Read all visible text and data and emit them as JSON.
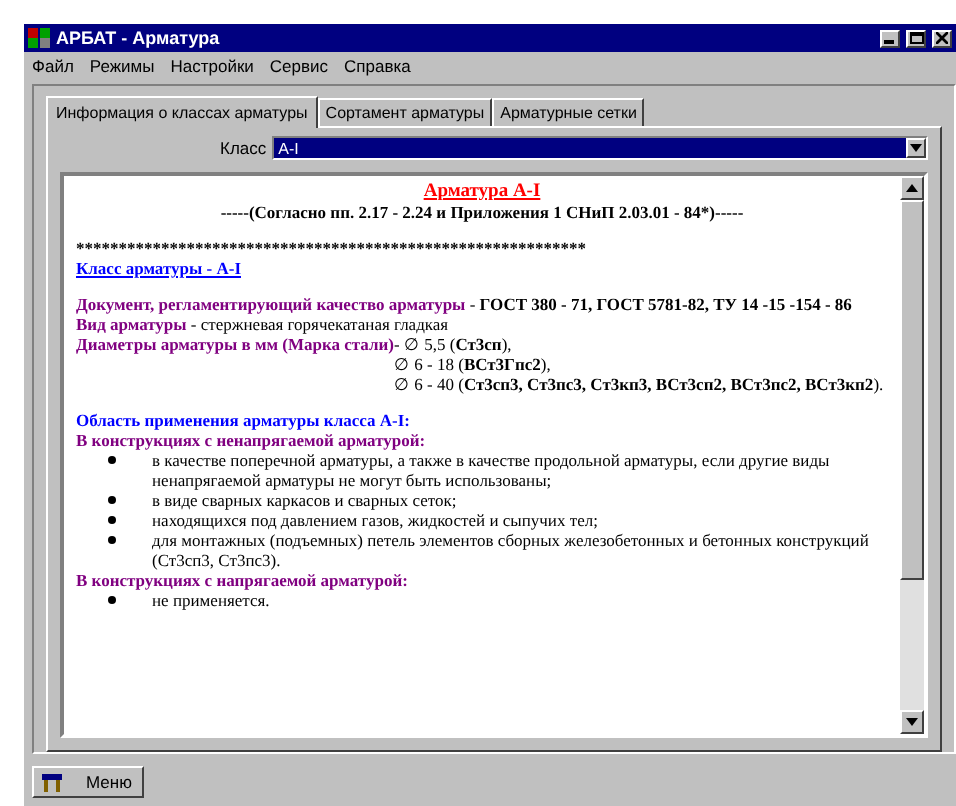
{
  "window": {
    "title": "АРБАТ - Арматура"
  },
  "menu": [
    "Файл",
    "Режимы",
    "Настройки",
    "Сервис",
    "Справка"
  ],
  "tabs": [
    {
      "label": "Информация о классах арматуры",
      "selected": true
    },
    {
      "label": "Сортамент арматуры",
      "selected": false
    },
    {
      "label": "Арматурные сетки",
      "selected": false
    }
  ],
  "class_field": {
    "label": "Класс",
    "value": "A-I"
  },
  "document": [
    {
      "kind": "title",
      "text": "Арматура А-I"
    },
    {
      "kind": "subtitle",
      "text": "-----(Согласно пп. 2.17 - 2.24 и Приложения 1 СНиП 2.03.01 - 84*)-----"
    },
    {
      "kind": "rule",
      "text": "************************************************************"
    },
    {
      "kind": "link",
      "text": " Класс арматуры - А-I"
    },
    {
      "kind": "field",
      "label": "Документ, регламентирующий качество арматуры",
      "value": " - **ГОСТ 380 - 71, ГОСТ 5781-82, ТУ 14 -15 -154 - 86**"
    },
    {
      "kind": "field",
      "label": "Вид арматуры",
      "value": " - стержневая горячекатаная гладкая"
    },
    {
      "kind": "lines",
      "label": "Диаметры арматуры в мм (Марка стали)",
      "lines": [
        " - ∅ 5,5 (**Ст3сп**),",
        "∅ 6 - 18 (**ВСт3Гпс2**),",
        "∅ 6 -  40 (**Ст3сп3, Ст3пс3, Ст3кп3, ВСт3сп2, ВСт3пс2, ВСт3кп2**)."
      ]
    },
    {
      "kind": "heading",
      "text": "Область применения арматуры класса А-I:"
    },
    {
      "kind": "subheading",
      "text": "В конструкциях с ненапрягаемой арматурой:"
    },
    {
      "kind": "bullet",
      "text": "в качестве поперечной арматуры, а также в качестве продольной арматуры, если другие виды ненапрягаемой арматуры не могут быть использованы;"
    },
    {
      "kind": "bullet",
      "text": "в виде сварных каркасов и сварных сеток;"
    },
    {
      "kind": "bullet",
      "text": "находящихся под давлением газов, жидкостей и сыпучих тел;"
    },
    {
      "kind": "bullet",
      "text": "для монтажных (подъемных) петель элементов сборных железобетонных и бетонных конструкций (Ст3сп3, Ст3пс3)."
    },
    {
      "kind": "subheading",
      "text": "В конструкциях с напрягаемой арматурой:"
    },
    {
      "kind": "bullet",
      "text": "не применяется."
    }
  ],
  "taskbar": {
    "button": "Меню"
  }
}
